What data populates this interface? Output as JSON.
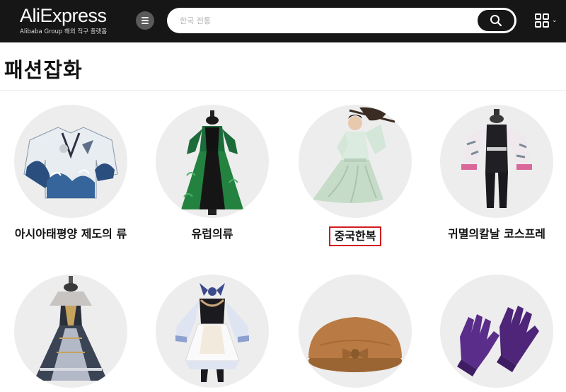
{
  "header": {
    "logo_text": "AliExpress",
    "logo_subtitle": "Alibaba Group 해외 직구 플랫폼",
    "search_placeholder": "한국 전통",
    "menu_icon": "menu-icon",
    "search_icon": "search-icon",
    "qr_icon": "qr-code-icon"
  },
  "page": {
    "category_title": "패션잡화"
  },
  "categories": [
    {
      "label": "아시아태평양 제도의 류",
      "icon": "kimono-jacket",
      "highlighted": false
    },
    {
      "label": "유럽의류",
      "icon": "victorian-gown",
      "highlighted": false
    },
    {
      "label": "중국한복",
      "icon": "hanfu-dress",
      "highlighted": true
    },
    {
      "label": "귀멸의칼날 코스프레",
      "icon": "cosplay-haori",
      "highlighted": false
    },
    {
      "label": "",
      "icon": "lolita-dress",
      "highlighted": false
    },
    {
      "label": "",
      "icon": "maid-costume",
      "highlighted": false
    },
    {
      "label": "",
      "icon": "beret-hat",
      "highlighted": false
    },
    {
      "label": "",
      "icon": "knit-gloves",
      "highlighted": false
    }
  ],
  "colors": {
    "header_bg": "#161616",
    "highlight_border": "#d01c20",
    "circle_bg": "#ededed"
  }
}
